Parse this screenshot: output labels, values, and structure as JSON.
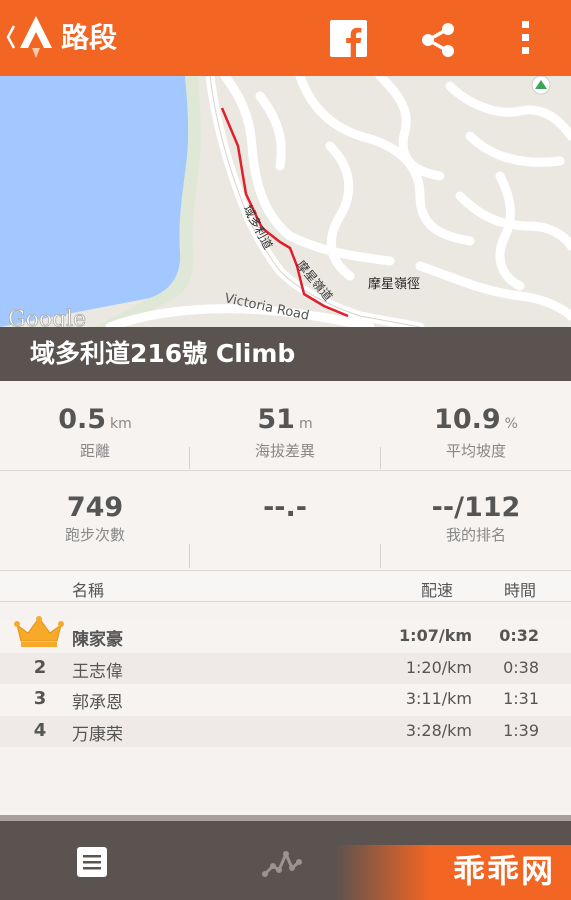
{
  "app_bar": {
    "title": "路段"
  },
  "map": {
    "attribution": "Google",
    "labels": {
      "road_zh_1": "域多利道",
      "road_zh_2": "摩星嶺道",
      "trail_zh": "摩星嶺徑",
      "road_en": "Victoria Road"
    }
  },
  "segment": {
    "title": "域多利道216號 Climb"
  },
  "stats": [
    {
      "value": "0.5",
      "unit": "km",
      "label": "距離"
    },
    {
      "value": "51",
      "unit": "m",
      "label": "海拔差異"
    },
    {
      "value": "10.9",
      "unit": "%",
      "label": "平均坡度"
    },
    {
      "value": "749",
      "unit": "",
      "label": "跑步次數"
    },
    {
      "value": "--.-",
      "unit": "",
      "label": ""
    },
    {
      "value": "--/112",
      "unit": "",
      "label": "我的排名"
    }
  ],
  "leaderboard": {
    "headers": {
      "name": "名稱",
      "pace": "配速",
      "time": "時間"
    },
    "rows": [
      {
        "rank": "",
        "name": "陳家豪",
        "pace": "1:07/km",
        "time": "0:32"
      },
      {
        "rank": "2",
        "name": "王志偉",
        "pace": "1:20/km",
        "time": "0:38"
      },
      {
        "rank": "3",
        "name": "郭承恩",
        "pace": "3:11/km",
        "time": "1:31"
      },
      {
        "rank": "4",
        "name": "万康荣",
        "pace": "3:28/km",
        "time": "1:39"
      }
    ]
  },
  "watermark": {
    "text": "乖乖网"
  },
  "colors": {
    "brand": "#f26522",
    "band": "#5b5350",
    "water": "#a3c8ff",
    "segment_line": "#e0202a"
  },
  "icons": [
    "back-chevron-icon",
    "strava-logo-icon",
    "facebook-icon",
    "share-icon",
    "more-vert-icon",
    "crown-icon",
    "list-icon",
    "activity-graph-icon"
  ]
}
